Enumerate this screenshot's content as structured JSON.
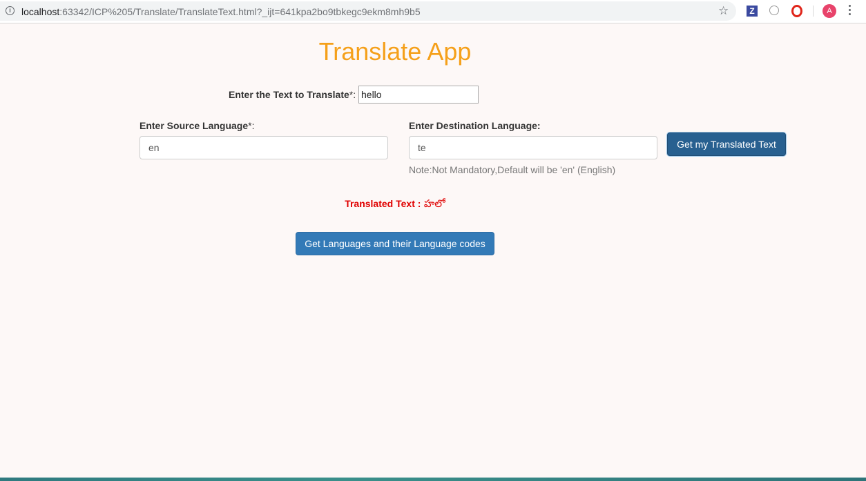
{
  "browser": {
    "url_host": "localhost",
    "url_rest": ":63342/ICP%205/Translate/TranslateText.html?_ijt=641kpa2bo9tbkegc9ekm8mh9b5",
    "avatar_letter": "A",
    "extension_z_label": "Z"
  },
  "page": {
    "title": "Translate App",
    "text_label": "Enter the Text to Translate",
    "required_mark": "*:",
    "text_value": "hello",
    "source_label": "Enter Source Language",
    "source_required": "*:",
    "source_value": "en",
    "destination_label": "Enter Destination Language:",
    "destination_value": "te",
    "translate_button": "Get my Translated Text",
    "note": "Note:Not Mandatory,Default will be 'en' (English)",
    "result_label": "Translated Text :",
    "result_value": "హలో",
    "languages_button": "Get Languages and their Language codes"
  },
  "colors": {
    "title": "#f5a01a",
    "primary_button": "#337ab7",
    "active_button": "#286090",
    "result_text": "#e00000",
    "page_background": "#fdf8f7"
  }
}
